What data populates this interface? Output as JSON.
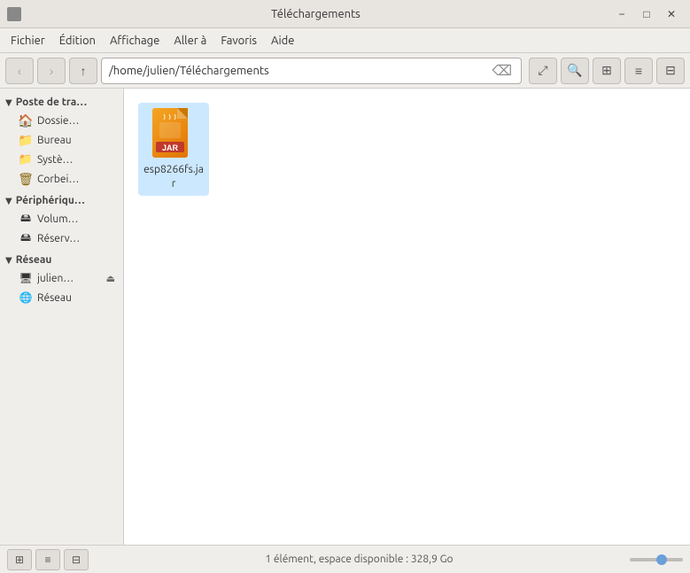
{
  "titlebar": {
    "title": "Téléchargements",
    "minimize_label": "−",
    "maximize_label": "□",
    "close_label": "✕"
  },
  "menubar": {
    "items": [
      {
        "id": "fichier",
        "label": "Fichier"
      },
      {
        "id": "edition",
        "label": "Édition"
      },
      {
        "id": "affichage",
        "label": "Affichage"
      },
      {
        "id": "aller_a",
        "label": "Aller à"
      },
      {
        "id": "favoris",
        "label": "Favoris"
      },
      {
        "id": "aide",
        "label": "Aide"
      }
    ]
  },
  "toolbar": {
    "back_label": "‹",
    "forward_label": "›",
    "up_label": "↑",
    "address": "/home/julien/Téléchargements",
    "clear_icon": "⌫",
    "location_icon": "⤢",
    "search_icon": "🔍",
    "grid_icon": "⊞",
    "list_icon": "≡",
    "details_icon": "⊟"
  },
  "sidebar": {
    "sections": [
      {
        "id": "poste-de-travail",
        "label": "Poste de tra…",
        "expanded": true,
        "items": [
          {
            "id": "dossier",
            "label": "Dossie…",
            "icon": "home"
          },
          {
            "id": "bureau",
            "label": "Bureau",
            "icon": "folder"
          },
          {
            "id": "systeme",
            "label": "Systè…",
            "icon": "folder"
          },
          {
            "id": "corbeille",
            "label": "Corbei…",
            "icon": "trash"
          }
        ]
      },
      {
        "id": "peripheriques",
        "label": "Périphériqu…",
        "expanded": true,
        "items": [
          {
            "id": "volume",
            "label": "Volum…",
            "icon": "drive"
          },
          {
            "id": "reserve",
            "label": "Réserv…",
            "icon": "drive"
          }
        ]
      },
      {
        "id": "reseau",
        "label": "Réseau",
        "expanded": true,
        "items": [
          {
            "id": "julien",
            "label": "julien…",
            "icon": "network",
            "eject": true
          },
          {
            "id": "reseau",
            "label": "Réseau",
            "icon": "network"
          }
        ]
      }
    ]
  },
  "files": [
    {
      "id": "esp8266fs",
      "name": "esp8266fs.jar",
      "type": "jar",
      "badge": "JAR"
    }
  ],
  "statusbar": {
    "text": "1 élément, espace disponible : 328,9 Go",
    "btn1": "⊞",
    "btn2": "≡",
    "btn3": "⊟"
  }
}
